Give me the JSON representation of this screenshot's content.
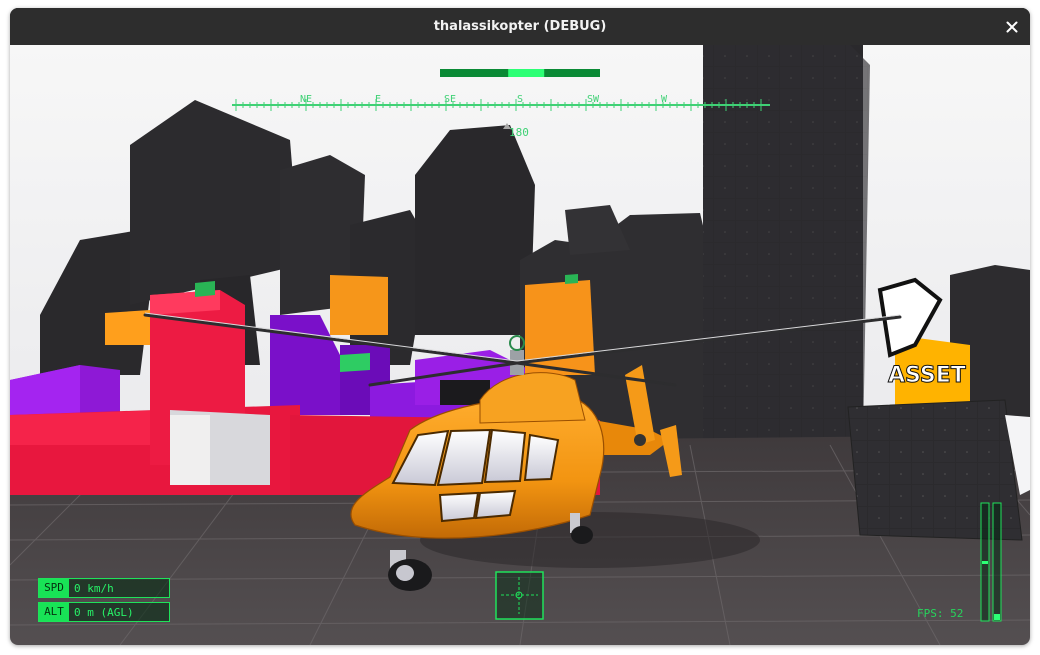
{
  "window": {
    "title": "thalassikopter (DEBUG)"
  },
  "hud": {
    "compass": {
      "labels": [
        "NE",
        "E",
        "SE",
        "S",
        "SW",
        "W"
      ],
      "heading": "180"
    },
    "speed": {
      "label": "SPD",
      "value": "0 km/h"
    },
    "altitude": {
      "label": "ALT",
      "value": "0 m (AGL)"
    },
    "fps": "FPS: 52",
    "throttle_level": 0.55,
    "collective_level": 0.05,
    "hud_color": "#1fe25a"
  },
  "scene": {
    "billboard_text": "ASSET"
  }
}
